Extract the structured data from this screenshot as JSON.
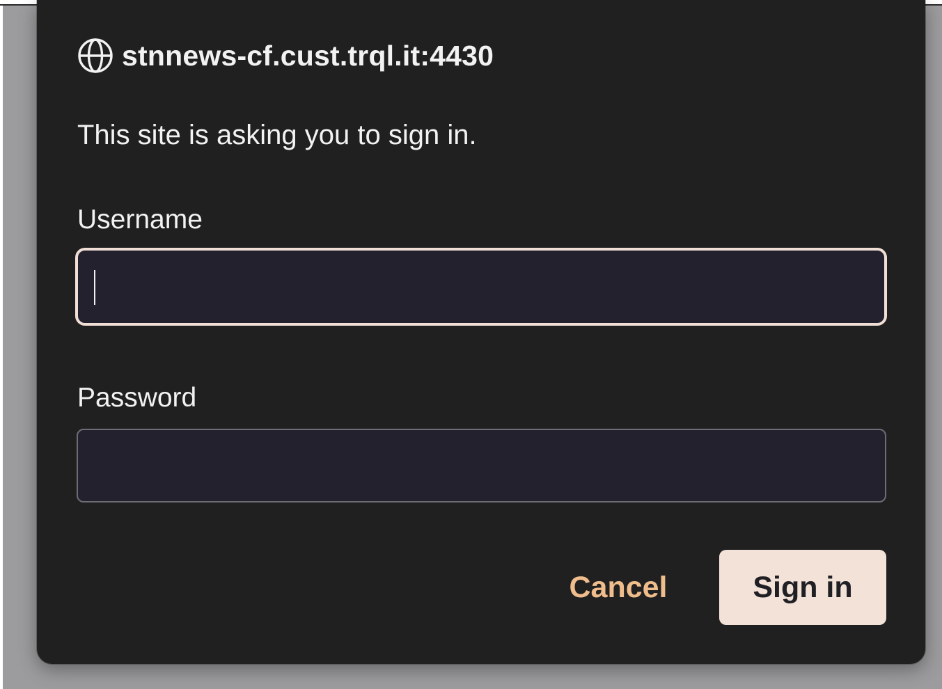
{
  "dialog": {
    "globe_icon": "globe-icon",
    "host": "stnnews-cf.cust.trql.it:4430",
    "message": "This site is asking you to sign in.",
    "username": {
      "label": "Username",
      "value": "",
      "placeholder": ""
    },
    "password": {
      "label": "Password",
      "value": "",
      "placeholder": ""
    },
    "buttons": {
      "cancel": "Cancel",
      "sign_in": "Sign in"
    }
  },
  "colors": {
    "dialog_bg": "#202020",
    "field_bg": "#23212d",
    "focus_ring": "#f1dfd6",
    "accent_text": "#f0bd8c",
    "primary_button_bg": "#f3e2d8",
    "backdrop": "#9c9c9e"
  }
}
